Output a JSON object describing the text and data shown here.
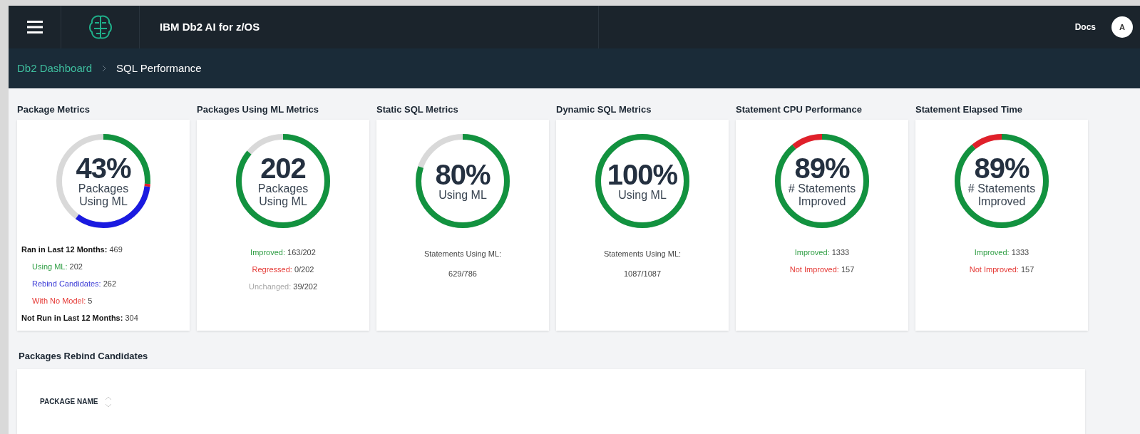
{
  "header": {
    "title": "IBM Db2 AI for z/OS",
    "docs": "Docs",
    "avatar": "A"
  },
  "breadcrumb": [
    {
      "label": "Db2 Dashboard",
      "kind": "link"
    },
    {
      "label": "SQL Performance",
      "kind": "current"
    }
  ],
  "metrics": [
    {
      "title": "Package Metrics",
      "value": "43%",
      "caption": [
        "Packages",
        "Using ML"
      ],
      "segments": [
        {
          "color": "#12923f",
          "level": 0.26
        },
        {
          "color": "#e0202a",
          "level": 0.01
        },
        {
          "color": "#1a1ae0",
          "level": 0.33
        }
      ],
      "lines": [
        {
          "kind": "heading",
          "label": "Ran in Last 12 Months:",
          "value": "469"
        },
        {
          "kind": "item",
          "label": "Using ML:",
          "value": "202",
          "color": "#2f9e44"
        },
        {
          "kind": "item",
          "label": "Rebind Candidates:",
          "value": "262",
          "color": "#3b3bd6"
        },
        {
          "kind": "item",
          "label": "With No Model:",
          "value": "5",
          "color": "#e53935"
        },
        {
          "kind": "heading",
          "label": "Not Run in Last 12 Months:",
          "value": "304"
        }
      ]
    },
    {
      "title": "Packages Using ML Metrics",
      "value": "202",
      "caption": [
        "Packages",
        "Using ML"
      ],
      "segments": [
        {
          "color": "#12923f",
          "level": 0.86
        }
      ],
      "lines": [
        {
          "kind": "item",
          "label": "Improved:",
          "value": "163/202",
          "color": "#2f9e44"
        },
        {
          "kind": "item",
          "label": "Regressed:",
          "value": "0/202",
          "color": "#e53935"
        },
        {
          "kind": "item",
          "label": "Unchanged:",
          "value": "39/202",
          "color": "#a8a8a8"
        }
      ]
    },
    {
      "title": "Static SQL Metrics",
      "value": "80%",
      "caption": [
        "Using ML"
      ],
      "segments": [
        {
          "color": "#12923f",
          "level": 0.8
        }
      ],
      "lines": [
        {
          "kind": "plain",
          "label": "Statements Using ML:"
        },
        {
          "kind": "plain",
          "label": "629/786"
        }
      ]
    },
    {
      "title": "Dynamic SQL Metrics",
      "value": "100%",
      "caption": [
        "Using ML"
      ],
      "segments": [
        {
          "color": "#12923f",
          "level": 1
        }
      ],
      "lines": [
        {
          "kind": "plain",
          "label": "Statements Using ML:"
        },
        {
          "kind": "plain",
          "label": "1087/1087"
        }
      ]
    },
    {
      "title": "Statement CPU Performance",
      "value": "89%",
      "caption": [
        "# Statements",
        "Improved"
      ],
      "segments": [
        {
          "color": "#12923f",
          "level": 0.89
        },
        {
          "color": "#e0202a",
          "level": 0.11
        }
      ],
      "lines": [
        {
          "kind": "item",
          "label": "Improved:",
          "value": "1333",
          "color": "#2f9e44"
        },
        {
          "kind": "item",
          "label": "Not Improved:",
          "value": "157",
          "color": "#e53935"
        }
      ]
    },
    {
      "title": "Statement Elapsed Time",
      "value": "89%",
      "caption": [
        "# Statements",
        "Improved"
      ],
      "segments": [
        {
          "color": "#12923f",
          "level": 0.89
        },
        {
          "color": "#e0202a",
          "level": 0.11
        }
      ],
      "lines": [
        {
          "kind": "item",
          "label": "Improved:",
          "value": "1333",
          "color": "#2f9e44"
        },
        {
          "kind": "item",
          "label": "Not Improved:",
          "value": "157",
          "color": "#e53935"
        }
      ]
    }
  ],
  "rebind": {
    "title": "Packages Rebind Candidates",
    "columns": [
      "PACKAGE NAME"
    ]
  }
}
